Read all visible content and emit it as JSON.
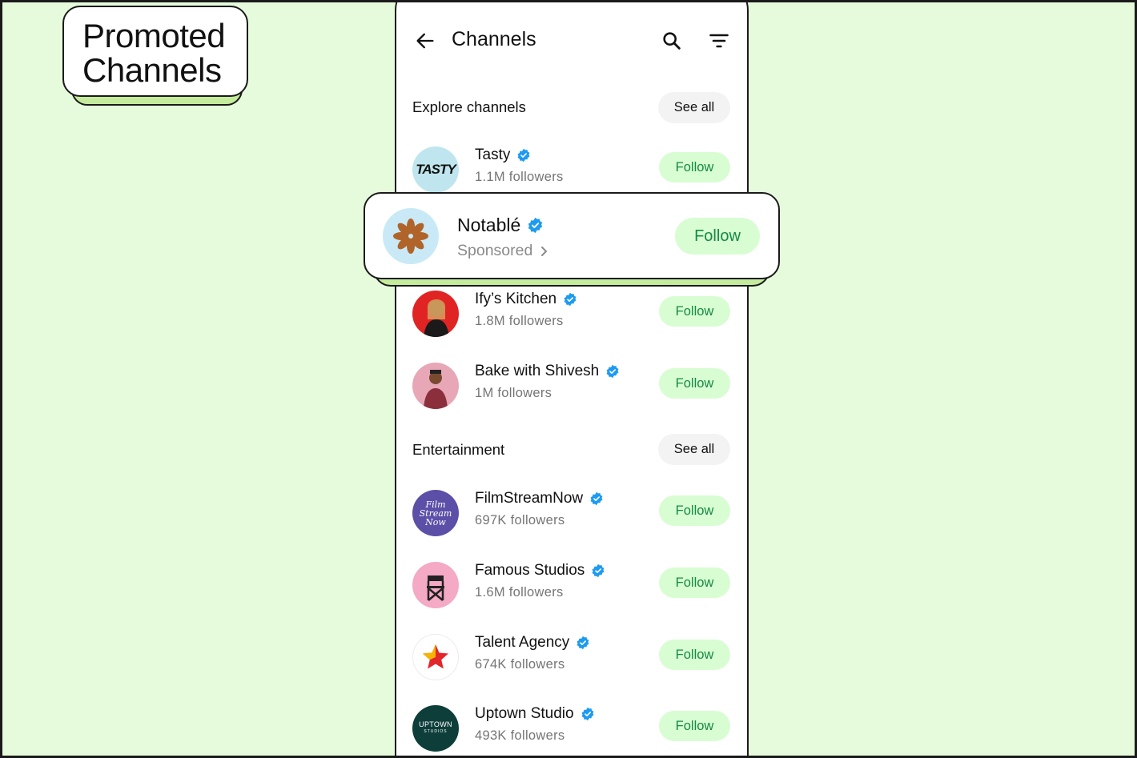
{
  "promo": {
    "line1": "Promoted",
    "line2": "Channels"
  },
  "header": {
    "title": "Channels"
  },
  "sections": {
    "explore": {
      "title": "Explore channels",
      "see_all": "See all"
    },
    "entertainment": {
      "title": "Entertainment",
      "see_all": "See all"
    }
  },
  "explore_channels": [
    {
      "name": "Tasty",
      "followers": "1.1M followers",
      "follow": "Follow",
      "avatar_text": "TASTY"
    },
    {
      "name": "Ify’s Kitchen",
      "followers": "1.8M followers",
      "follow": "Follow"
    },
    {
      "name": "Bake with Shivesh",
      "followers": "1M followers",
      "follow": "Follow"
    }
  ],
  "sponsored": {
    "name": "Notablé",
    "sub": "Sponsored",
    "follow": "Follow"
  },
  "entertainment_channels": [
    {
      "name": "FilmStreamNow",
      "followers": "697K followers",
      "follow": "Follow",
      "avatar_text_1": "Film",
      "avatar_text_2": "Stream",
      "avatar_text_3": "Now"
    },
    {
      "name": "Famous Studios",
      "followers": "1.6M followers",
      "follow": "Follow"
    },
    {
      "name": "Talent Agency",
      "followers": "674K followers",
      "follow": "Follow"
    },
    {
      "name": "Uptown Studio",
      "followers": "493K followers",
      "follow": "Follow",
      "avatar_text_1": "UPTOWN",
      "avatar_text_2": "STUDIOS"
    }
  ],
  "colors": {
    "background": "#e6fbdc",
    "accent_green": "#158a46",
    "follow_bg": "#d8fdd2",
    "verified": "#1d9bf0",
    "shadow_green": "#c5ec9c"
  }
}
